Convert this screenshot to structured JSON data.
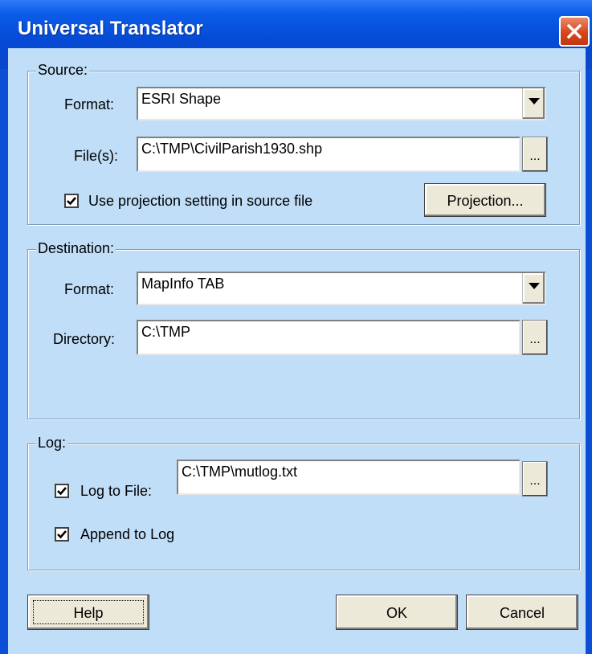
{
  "window": {
    "title": "Universal Translator"
  },
  "source": {
    "legend": "Source:",
    "format_label": "Format:",
    "format_value": "ESRI Shape",
    "files_label": "File(s):",
    "files_value": "C:\\TMP\\CivilParish1930.shp",
    "browse_label": "...",
    "use_projection_label": "Use projection setting in source file",
    "use_projection_checked": true,
    "projection_button": "Projection..."
  },
  "destination": {
    "legend": "Destination:",
    "format_label": "Format:",
    "format_value": "MapInfo TAB",
    "directory_label": "Directory:",
    "directory_value": "C:\\TMP",
    "browse_label": "..."
  },
  "log": {
    "legend": "Log:",
    "log_to_file_label": "Log to File:",
    "log_to_file_checked": true,
    "log_file_value": "C:\\TMP\\mutlog.txt",
    "browse_label": "...",
    "append_label": "Append to Log",
    "append_checked": true
  },
  "buttons": {
    "help": "Help",
    "ok": "OK",
    "cancel": "Cancel"
  },
  "colors": {
    "titlebar": "#0549d4",
    "client": "#c0def7",
    "close": "#d7451c"
  },
  "icons": {
    "close": "close-icon",
    "dropdown": "chevron-down-icon",
    "check": "check-icon"
  }
}
